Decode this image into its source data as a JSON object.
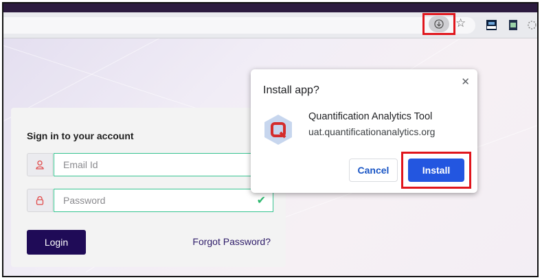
{
  "browser": {
    "install_icon": "install-app-icon",
    "bookmark_icon": "star-icon",
    "extensions": [
      "new-extension-icon",
      "sheet-extension-icon",
      "loading-extension-icon"
    ]
  },
  "login": {
    "title": "Sign in to your account",
    "email_placeholder": "Email Id",
    "password_placeholder": "Password",
    "login_label": "Login",
    "forgot_label": "Forgot Password?",
    "email_icon": "user-icon",
    "password_icon": "lock-icon",
    "valid_icon": "check-icon"
  },
  "install_popup": {
    "title": "Install app?",
    "app_name": "Quantification Analytics Tool",
    "app_url": "uat.quantificationanalytics.org",
    "cancel_label": "Cancel",
    "install_label": "Install",
    "close_icon": "close-icon",
    "app_icon": "app-logo-icon"
  },
  "colors": {
    "highlight": "#e0151c",
    "install_button": "#2356e0",
    "login_button": "#1f0b57",
    "valid_border": "#34c38f"
  }
}
